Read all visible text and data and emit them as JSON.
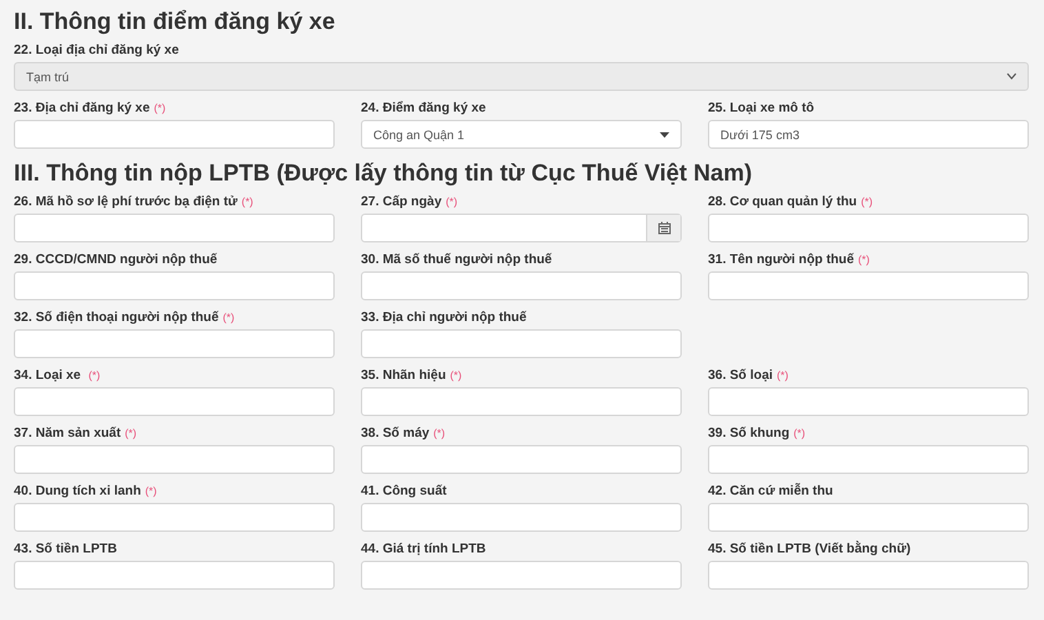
{
  "sections": [
    {
      "title": "II. Thông tin điểm đăng ký xe",
      "rows": [
        [
          {
            "label": "22. Loại địa chỉ đăng ký xe",
            "kind": "select",
            "value": "Tạm trú",
            "disabled": true
          }
        ],
        [
          {
            "label": "23. Địa chỉ đăng ký xe",
            "required_mark": "(*)",
            "kind": "text"
          },
          {
            "label": "24. Điểm đăng ký xe",
            "kind": "dropdown",
            "value": "Công an Quận 1"
          },
          {
            "label": "25. Loại xe mô tô",
            "kind": "text",
            "value": "Dưới 175 cm3"
          }
        ]
      ]
    },
    {
      "title": "III. Thông tin nộp LPTB (Được lấy thông tin từ Cục Thuế Việt Nam)",
      "rows": [
        [
          {
            "label": "26. Mã hồ sơ lệ phí trước bạ điện tử",
            "required_mark": "(*)",
            "kind": "text"
          },
          {
            "label": "27. Cấp ngày",
            "required_mark": "(*)",
            "kind": "date"
          },
          {
            "label": "28. Cơ quan quản lý thu",
            "required_mark": "(*)",
            "kind": "text"
          }
        ],
        [
          {
            "label": "29. CCCD/CMND người nộp thuế",
            "kind": "text"
          },
          {
            "label": "30. Mã số thuế người nộp thuế",
            "kind": "text"
          },
          {
            "label": "31. Tên người nộp thuế",
            "required_mark": "(*)",
            "kind": "text"
          }
        ],
        [
          {
            "label": "32. Số điện thoại người nộp thuế",
            "required_mark": "(*)",
            "kind": "text"
          },
          {
            "label": "33. Địa chỉ người nộp thuế",
            "kind": "text"
          }
        ],
        [
          {
            "label": "34. Loại xe ",
            "required_mark": "(*)",
            "kind": "text"
          },
          {
            "label": "35. Nhãn hiệu",
            "required_mark": "(*)",
            "kind": "text"
          },
          {
            "label": "36. Số loại",
            "required_mark": "(*)",
            "kind": "text"
          }
        ],
        [
          {
            "label": "37. Năm sản xuất",
            "required_mark": "(*)",
            "kind": "text"
          },
          {
            "label": "38. Số máy",
            "required_mark": "(*)",
            "kind": "text"
          },
          {
            "label": "39. Số khung",
            "required_mark": "(*)",
            "kind": "text"
          }
        ],
        [
          {
            "label": "40. Dung tích xi lanh",
            "required_mark": "(*)",
            "kind": "text"
          },
          {
            "label": "41. Công suất",
            "kind": "text"
          },
          {
            "label": "42. Căn cứ miễn thu",
            "kind": "text"
          }
        ],
        [
          {
            "label": "43. Số tiền LPTB",
            "kind": "text"
          },
          {
            "label": "44. Giá trị tính LPTB",
            "kind": "text"
          },
          {
            "label": "45. Số tiền LPTB (Viết bằng chữ)",
            "kind": "text"
          }
        ]
      ]
    }
  ]
}
